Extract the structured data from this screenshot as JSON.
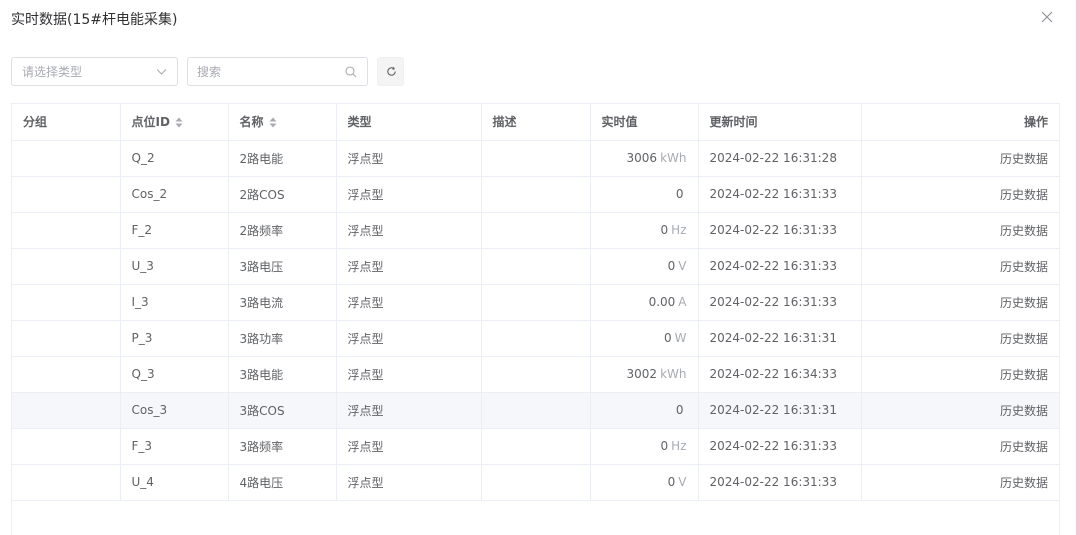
{
  "dialog": {
    "title": "实时数据(15#杆电能采集)"
  },
  "toolbar": {
    "type_select_placeholder": "请选择类型",
    "search_placeholder": "搜索"
  },
  "table": {
    "headers": {
      "group": "分组",
      "point_id": "点位ID",
      "name": "名称",
      "type": "类型",
      "desc": "描述",
      "value": "实时值",
      "time": "更新时间",
      "action": "操作"
    },
    "rows": [
      {
        "group": "",
        "point_id": "Q_2",
        "name": "2路电能",
        "type": "浮点型",
        "desc": "",
        "value": "3006",
        "unit": "kWh",
        "time": "2024-02-22 16:31:28",
        "action": "历史数据"
      },
      {
        "group": "",
        "point_id": "Cos_2",
        "name": "2路COS",
        "type": "浮点型",
        "desc": "",
        "value": "0",
        "unit": "",
        "time": "2024-02-22 16:31:33",
        "action": "历史数据"
      },
      {
        "group": "",
        "point_id": "F_2",
        "name": "2路频率",
        "type": "浮点型",
        "desc": "",
        "value": "0",
        "unit": "Hz",
        "time": "2024-02-22 16:31:33",
        "action": "历史数据"
      },
      {
        "group": "",
        "point_id": "U_3",
        "name": "3路电压",
        "type": "浮点型",
        "desc": "",
        "value": "0",
        "unit": "V",
        "time": "2024-02-22 16:31:33",
        "action": "历史数据"
      },
      {
        "group": "",
        "point_id": "I_3",
        "name": "3路电流",
        "type": "浮点型",
        "desc": "",
        "value": "0.00",
        "unit": "A",
        "time": "2024-02-22 16:31:33",
        "action": "历史数据"
      },
      {
        "group": "",
        "point_id": "P_3",
        "name": "3路功率",
        "type": "浮点型",
        "desc": "",
        "value": "0",
        "unit": "W",
        "time": "2024-02-22 16:31:31",
        "action": "历史数据"
      },
      {
        "group": "",
        "point_id": "Q_3",
        "name": "3路电能",
        "type": "浮点型",
        "desc": "",
        "value": "3002",
        "unit": "kWh",
        "time": "2024-02-22 16:34:33",
        "action": "历史数据"
      },
      {
        "group": "",
        "point_id": "Cos_3",
        "name": "3路COS",
        "type": "浮点型",
        "desc": "",
        "value": "0",
        "unit": "",
        "time": "2024-02-22 16:31:31",
        "action": "历史数据"
      },
      {
        "group": "",
        "point_id": "F_3",
        "name": "3路频率",
        "type": "浮点型",
        "desc": "",
        "value": "0",
        "unit": "Hz",
        "time": "2024-02-22 16:31:33",
        "action": "历史数据"
      },
      {
        "group": "",
        "point_id": "U_4",
        "name": "4路电压",
        "type": "浮点型",
        "desc": "",
        "value": "0",
        "unit": "V",
        "time": "2024-02-22 16:31:33",
        "action": "历史数据"
      }
    ]
  },
  "colors": {
    "border": "#ebeef5",
    "text": "#606266",
    "placeholder": "#a8abb2",
    "hover_row": "#f5f7fa",
    "edge_accent": "#f2c9d2"
  },
  "icons": {
    "close": "close-icon",
    "select_chevron": "chevron-down-icon",
    "search": "search-icon",
    "refresh": "refresh-icon",
    "sort": "sort-icon"
  }
}
